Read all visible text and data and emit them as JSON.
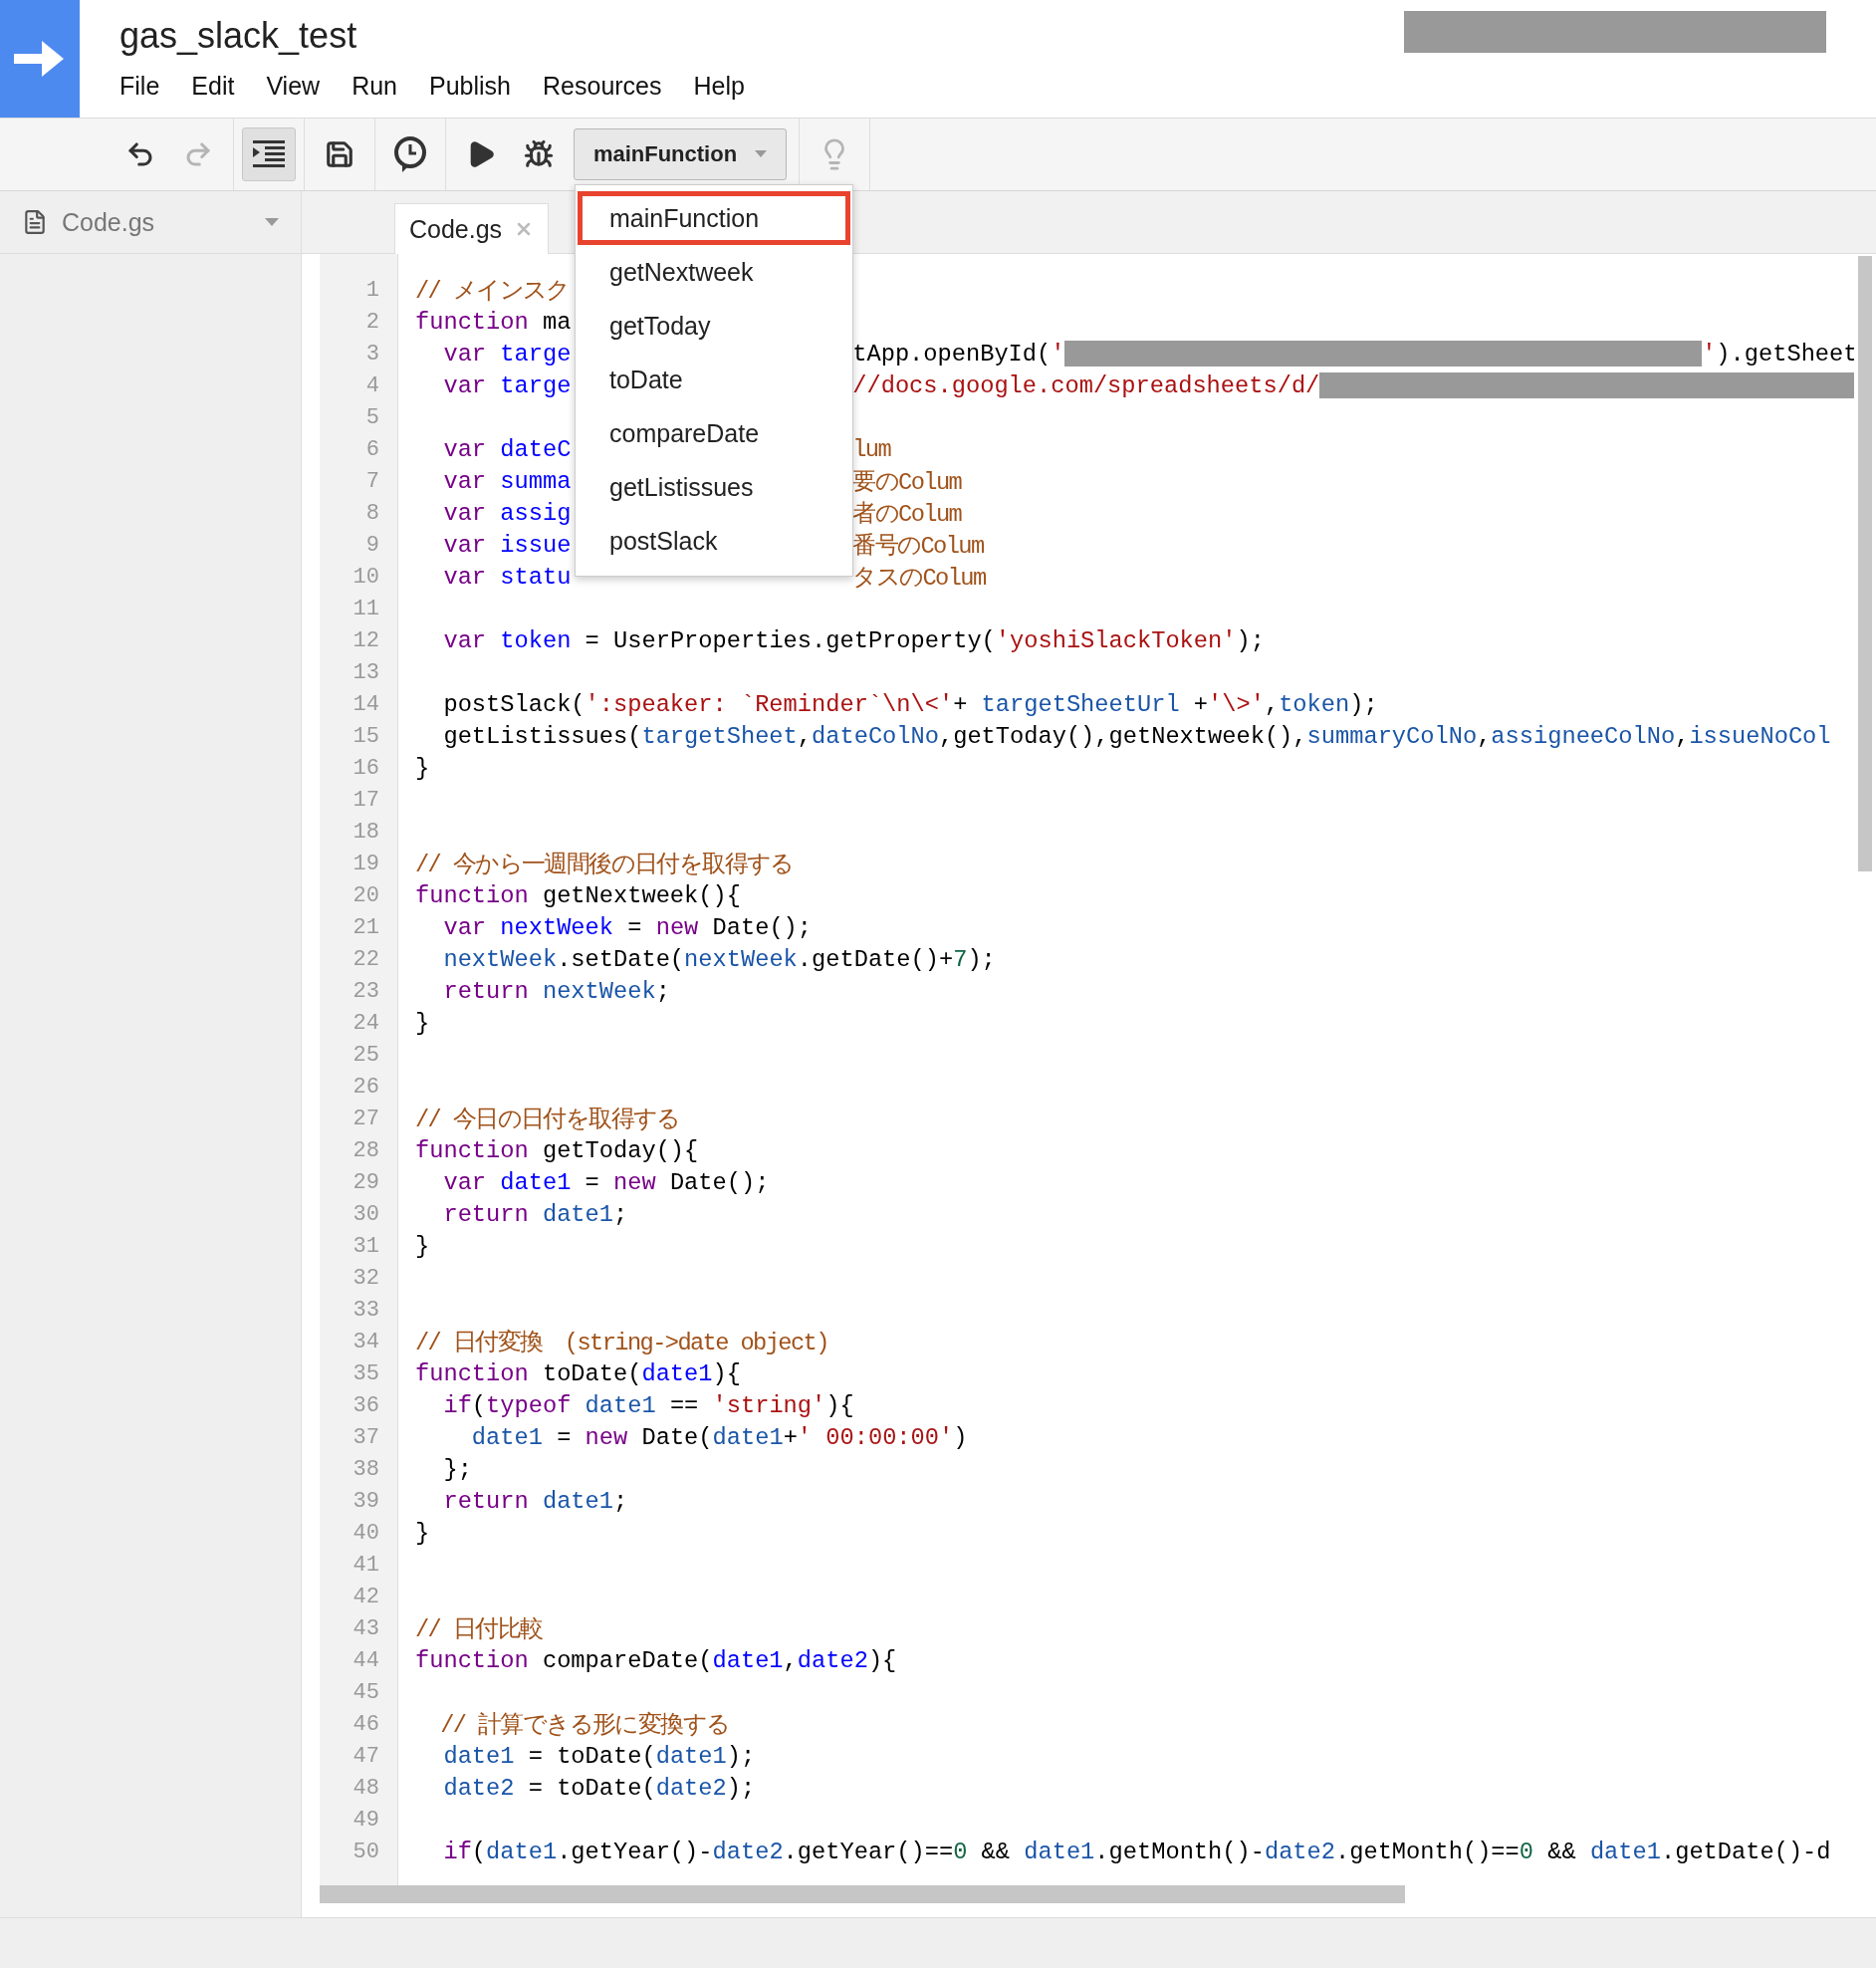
{
  "project": {
    "title": "gas_slack_test"
  },
  "menu": [
    "File",
    "Edit",
    "View",
    "Run",
    "Publish",
    "Resources",
    "Help"
  ],
  "toolbar": [
    {
      "kind": "undo",
      "disabled": false,
      "on": false
    },
    {
      "kind": "redo",
      "disabled": true,
      "on": false
    },
    {
      "kind": "indent",
      "disabled": false,
      "on": true
    },
    {
      "kind": "save",
      "disabled": false,
      "on": false
    },
    {
      "kind": "triggers",
      "disabled": false,
      "on": false
    },
    {
      "kind": "run",
      "disabled": false,
      "on": false
    },
    {
      "kind": "debug",
      "disabled": false,
      "on": false
    }
  ],
  "function_select": {
    "value": "mainFunction",
    "expanded": true,
    "items": [
      {
        "label": "mainFunction",
        "selected": true
      },
      {
        "label": "getNextweek",
        "selected": false
      },
      {
        "label": "getToday",
        "selected": false
      },
      {
        "label": "toDate",
        "selected": false
      },
      {
        "label": "compareDate",
        "selected": false
      },
      {
        "label": "getListissues",
        "selected": false
      },
      {
        "label": "postSlack",
        "selected": false
      }
    ]
  },
  "hint_button": {
    "disabled": true
  },
  "sidebar": {
    "files": [
      {
        "name": "Code.gs"
      }
    ]
  },
  "tabs": [
    {
      "label": "Code.gs",
      "selected": true
    }
  ],
  "code": [
    {
      "number": "1",
      "tokens": [
        {
          "kind": "comment",
          "text": "// メインスク"
        }
      ]
    },
    {
      "number": "2",
      "tokens": [
        {
          "kind": "keyword",
          "text": "function"
        },
        {
          "kind": "plain",
          "text": " ma"
        }
      ]
    },
    {
      "number": "3",
      "tokens": [
        {
          "kind": "keyword",
          "text": "  var"
        },
        {
          "kind": "def",
          "text": " targe"
        }
      ],
      "right": [
        {
          "kind": "plain",
          "text": "tApp.openById("
        },
        {
          "kind": "string",
          "text": "'"
        },
        {
          "kind": "redacted"
        },
        {
          "kind": "string",
          "text": "'"
        },
        {
          "kind": "plain",
          "text": ").getSheet"
        }
      ]
    },
    {
      "number": "4",
      "tokens": [
        {
          "kind": "keyword",
          "text": "  var"
        },
        {
          "kind": "def",
          "text": " targe"
        }
      ],
      "right": [
        {
          "kind": "string",
          "text": "//docs.google.com/spreadsheets/d/"
        },
        {
          "kind": "redacted"
        }
      ]
    },
    {
      "number": "5"
    },
    {
      "number": "6",
      "tokens": [
        {
          "kind": "keyword",
          "text": "  var"
        },
        {
          "kind": "def",
          "text": " dateC"
        }
      ],
      "right": [
        {
          "kind": "comment",
          "text": "lum"
        }
      ]
    },
    {
      "number": "7",
      "tokens": [
        {
          "kind": "keyword",
          "text": "  var"
        },
        {
          "kind": "def",
          "text": " summa"
        }
      ],
      "right": [
        {
          "kind": "comment",
          "text": "要のColum"
        }
      ]
    },
    {
      "number": "8",
      "tokens": [
        {
          "kind": "keyword",
          "text": "  var"
        },
        {
          "kind": "def",
          "text": " assig"
        }
      ],
      "right": [
        {
          "kind": "comment",
          "text": "者のColum"
        }
      ]
    },
    {
      "number": "9",
      "tokens": [
        {
          "kind": "keyword",
          "text": "  var"
        },
        {
          "kind": "def",
          "text": " issue"
        }
      ],
      "right": [
        {
          "kind": "comment",
          "text": "番号のColum"
        }
      ]
    },
    {
      "number": "10",
      "tokens": [
        {
          "kind": "keyword",
          "text": "  var"
        },
        {
          "kind": "def",
          "text": " statu"
        }
      ],
      "right": [
        {
          "kind": "comment",
          "text": "タスのColum"
        }
      ]
    },
    {
      "number": "11"
    },
    {
      "number": "12",
      "tokens": [
        {
          "kind": "keyword",
          "text": "  var"
        },
        {
          "kind": "def",
          "text": " token"
        },
        {
          "kind": "plain",
          "text": " = UserProperties.getProperty("
        },
        {
          "kind": "string",
          "text": "'yoshiSlackToken'"
        },
        {
          "kind": "plain",
          "text": ");"
        }
      ]
    },
    {
      "number": "13"
    },
    {
      "number": "14",
      "tokens": [
        {
          "kind": "plain",
          "text": "  postSlack("
        },
        {
          "kind": "string",
          "text": "':speaker: `Reminder`\\n\\<'"
        },
        {
          "kind": "plain",
          "text": "+ "
        },
        {
          "kind": "variable",
          "text": "targetSheetUrl"
        },
        {
          "kind": "plain",
          "text": " +"
        },
        {
          "kind": "string",
          "text": "'\\>'"
        },
        {
          "kind": "plain",
          "text": ","
        },
        {
          "kind": "variable",
          "text": "token"
        },
        {
          "kind": "plain",
          "text": ");"
        }
      ]
    },
    {
      "number": "15",
      "tokens": [
        {
          "kind": "plain",
          "text": "  getListissues("
        },
        {
          "kind": "variable",
          "text": "targetSheet"
        },
        {
          "kind": "plain",
          "text": ","
        },
        {
          "kind": "variable",
          "text": "dateColNo"
        },
        {
          "kind": "plain",
          "text": ",getToday(),getNextweek(),"
        },
        {
          "kind": "variable",
          "text": "summaryColNo"
        },
        {
          "kind": "plain",
          "text": ","
        },
        {
          "kind": "variable",
          "text": "assigneeColNo"
        },
        {
          "kind": "plain",
          "text": ","
        },
        {
          "kind": "variable",
          "text": "issueNoCol"
        }
      ]
    },
    {
      "number": "16",
      "tokens": [
        {
          "kind": "plain",
          "text": "}"
        }
      ]
    },
    {
      "number": "17"
    },
    {
      "number": "18"
    },
    {
      "number": "19",
      "tokens": [
        {
          "kind": "comment",
          "text": "// 今から一週間後の日付を取得する"
        }
      ]
    },
    {
      "number": "20",
      "tokens": [
        {
          "kind": "keyword",
          "text": "function"
        },
        {
          "kind": "plain",
          "text": " getNextweek(){"
        }
      ]
    },
    {
      "number": "21",
      "tokens": [
        {
          "kind": "keyword",
          "text": "  var"
        },
        {
          "kind": "def",
          "text": " nextWeek"
        },
        {
          "kind": "plain",
          "text": " = "
        },
        {
          "kind": "keyword",
          "text": "new"
        },
        {
          "kind": "plain",
          "text": " Date();"
        }
      ]
    },
    {
      "number": "22",
      "tokens": [
        {
          "kind": "variable",
          "text": "  nextWeek"
        },
        {
          "kind": "plain",
          "text": ".setDate("
        },
        {
          "kind": "variable",
          "text": "nextWeek"
        },
        {
          "kind": "plain",
          "text": ".getDate()+"
        },
        {
          "kind": "number",
          "text": "7"
        },
        {
          "kind": "plain",
          "text": ");"
        }
      ]
    },
    {
      "number": "23",
      "tokens": [
        {
          "kind": "keyword",
          "text": "  return"
        },
        {
          "kind": "variable",
          "text": " nextWeek"
        },
        {
          "kind": "plain",
          "text": ";"
        }
      ]
    },
    {
      "number": "24",
      "tokens": [
        {
          "kind": "plain",
          "text": "}"
        }
      ]
    },
    {
      "number": "25"
    },
    {
      "number": "26"
    },
    {
      "number": "27",
      "tokens": [
        {
          "kind": "comment",
          "text": "// 今日の日付を取得する"
        }
      ]
    },
    {
      "number": "28",
      "tokens": [
        {
          "kind": "keyword",
          "text": "function"
        },
        {
          "kind": "plain",
          "text": " getToday(){"
        }
      ]
    },
    {
      "number": "29",
      "tokens": [
        {
          "kind": "keyword",
          "text": "  var"
        },
        {
          "kind": "def",
          "text": " date1"
        },
        {
          "kind": "plain",
          "text": " = "
        },
        {
          "kind": "keyword",
          "text": "new"
        },
        {
          "kind": "plain",
          "text": " Date();"
        }
      ]
    },
    {
      "number": "30",
      "tokens": [
        {
          "kind": "keyword",
          "text": "  return"
        },
        {
          "kind": "variable",
          "text": " date1"
        },
        {
          "kind": "plain",
          "text": ";"
        }
      ]
    },
    {
      "number": "31",
      "tokens": [
        {
          "kind": "plain",
          "text": "}"
        }
      ]
    },
    {
      "number": "32"
    },
    {
      "number": "33"
    },
    {
      "number": "34",
      "tokens": [
        {
          "kind": "comment",
          "text": "// 日付変換　(string->date object)"
        }
      ]
    },
    {
      "number": "35",
      "tokens": [
        {
          "kind": "keyword",
          "text": "function"
        },
        {
          "kind": "plain",
          "text": " toDate("
        },
        {
          "kind": "def",
          "text": "date1"
        },
        {
          "kind": "plain",
          "text": "){"
        }
      ]
    },
    {
      "number": "36",
      "tokens": [
        {
          "kind": "keyword",
          "text": "  if"
        },
        {
          "kind": "plain",
          "text": "("
        },
        {
          "kind": "keyword",
          "text": "typeof"
        },
        {
          "kind": "variable",
          "text": " date1"
        },
        {
          "kind": "plain",
          "text": " == "
        },
        {
          "kind": "string",
          "text": "'string'"
        },
        {
          "kind": "plain",
          "text": "){"
        }
      ]
    },
    {
      "number": "37",
      "tokens": [
        {
          "kind": "variable",
          "text": "    date1"
        },
        {
          "kind": "plain",
          "text": " = "
        },
        {
          "kind": "keyword",
          "text": "new"
        },
        {
          "kind": "plain",
          "text": " Date("
        },
        {
          "kind": "variable",
          "text": "date1"
        },
        {
          "kind": "plain",
          "text": "+"
        },
        {
          "kind": "string",
          "text": "' 00:00:00'"
        },
        {
          "kind": "plain",
          "text": ")"
        }
      ]
    },
    {
      "number": "38",
      "tokens": [
        {
          "kind": "plain",
          "text": "  };"
        }
      ]
    },
    {
      "number": "39",
      "tokens": [
        {
          "kind": "keyword",
          "text": "  return"
        },
        {
          "kind": "variable",
          "text": " date1"
        },
        {
          "kind": "plain",
          "text": ";"
        }
      ]
    },
    {
      "number": "40",
      "tokens": [
        {
          "kind": "plain",
          "text": "}"
        }
      ]
    },
    {
      "number": "41"
    },
    {
      "number": "42"
    },
    {
      "number": "43",
      "tokens": [
        {
          "kind": "comment",
          "text": "// 日付比較"
        }
      ]
    },
    {
      "number": "44",
      "tokens": [
        {
          "kind": "keyword",
          "text": "function"
        },
        {
          "kind": "plain",
          "text": " compareDate("
        },
        {
          "kind": "def",
          "text": "date1"
        },
        {
          "kind": "plain",
          "text": ","
        },
        {
          "kind": "def",
          "text": "date2"
        },
        {
          "kind": "plain",
          "text": "){"
        }
      ]
    },
    {
      "number": "45"
    },
    {
      "number": "46",
      "tokens": [
        {
          "kind": "comment",
          "text": "  // 計算できる形に変換する"
        }
      ]
    },
    {
      "number": "47",
      "tokens": [
        {
          "kind": "variable",
          "text": "  date1"
        },
        {
          "kind": "plain",
          "text": " = toDate("
        },
        {
          "kind": "variable",
          "text": "date1"
        },
        {
          "kind": "plain",
          "text": ");"
        }
      ]
    },
    {
      "number": "48",
      "tokens": [
        {
          "kind": "variable",
          "text": "  date2"
        },
        {
          "kind": "plain",
          "text": " = toDate("
        },
        {
          "kind": "variable",
          "text": "date2"
        },
        {
          "kind": "plain",
          "text": ");"
        }
      ]
    },
    {
      "number": "49"
    },
    {
      "number": "50",
      "tokens": [
        {
          "kind": "keyword",
          "text": "  if"
        },
        {
          "kind": "plain",
          "text": "("
        },
        {
          "kind": "variable",
          "text": "date1"
        },
        {
          "kind": "plain",
          "text": ".getYear()-"
        },
        {
          "kind": "variable",
          "text": "date2"
        },
        {
          "kind": "plain",
          "text": ".getYear()=="
        },
        {
          "kind": "number",
          "text": "0"
        },
        {
          "kind": "plain",
          "text": " && "
        },
        {
          "kind": "variable",
          "text": "date1"
        },
        {
          "kind": "plain",
          "text": ".getMonth()-"
        },
        {
          "kind": "variable",
          "text": "date2"
        },
        {
          "kind": "plain",
          "text": ".getMonth()=="
        },
        {
          "kind": "number",
          "text": "0"
        },
        {
          "kind": "plain",
          "text": " && "
        },
        {
          "kind": "variable",
          "text": "date1"
        },
        {
          "kind": "plain",
          "text": ".getDate()-d"
        }
      ]
    }
  ]
}
